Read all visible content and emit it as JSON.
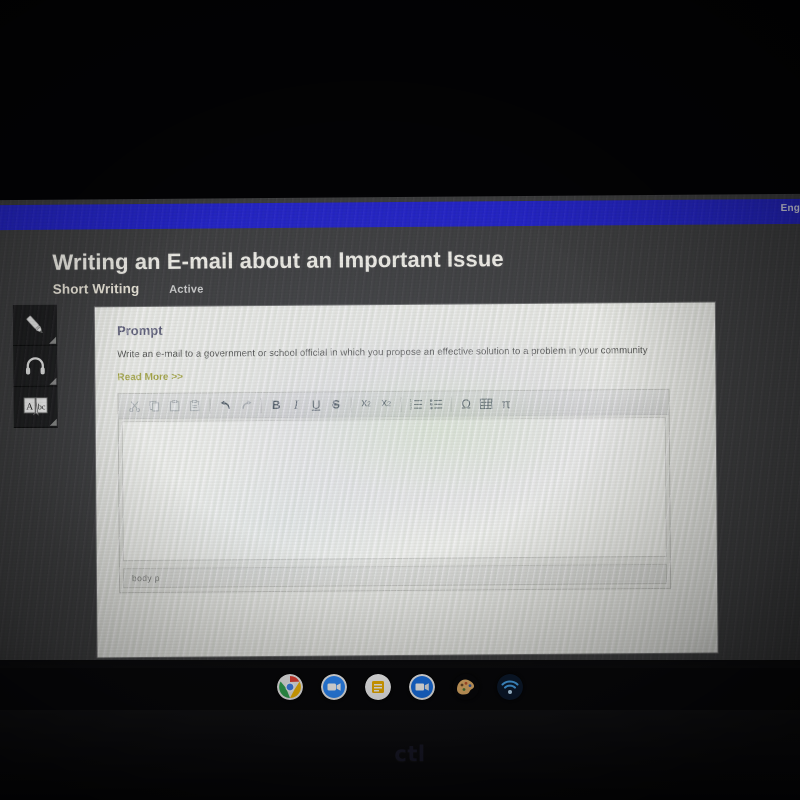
{
  "device": {
    "brand_logo": "ctl"
  },
  "browser": {
    "top_bar_color": "#2222c4",
    "language_label": "Eng"
  },
  "header": {
    "title": "Writing an E-mail about an Important Issue",
    "tab_label": "Short Writing",
    "status_label": "Active"
  },
  "toolrail": {
    "items": [
      {
        "icon": "pencil-icon",
        "name": "highlighter-tool"
      },
      {
        "icon": "headphones-icon",
        "name": "text-to-speech-tool"
      },
      {
        "icon": "dictionary-icon",
        "name": "dictionary-tool"
      }
    ]
  },
  "prompt": {
    "heading": "Prompt",
    "text": "Write an e-mail to a government or school official in which you propose an effective solution to a problem in your community",
    "read_more_label": "Read More >>",
    "read_more_color": "#9a9a2e",
    "heading_color": "#4a4a6a"
  },
  "editor": {
    "toolbar": [
      {
        "name": "cut-icon",
        "label": "✂",
        "enabled": false
      },
      {
        "name": "copy-icon",
        "label": "❐",
        "enabled": false
      },
      {
        "name": "paste-icon",
        "label": "ὌB",
        "enabled": false
      },
      {
        "name": "paste-from-word-icon",
        "label": "὜D",
        "enabled": false
      },
      {
        "name": "undo-icon",
        "label": "↶",
        "enabled": true
      },
      {
        "name": "redo-icon",
        "label": "↷",
        "enabled": false
      },
      {
        "name": "bold-button",
        "label": "B",
        "enabled": true
      },
      {
        "name": "italic-button",
        "label": "I",
        "enabled": true
      },
      {
        "name": "underline-button",
        "label": "U",
        "enabled": true
      },
      {
        "name": "strikethrough-button",
        "label": "S",
        "enabled": true
      },
      {
        "name": "subscript-button",
        "label": "x",
        "enabled": true
      },
      {
        "name": "superscript-button",
        "label": "x",
        "enabled": true
      },
      {
        "name": "numbered-list-icon",
        "label": "",
        "enabled": true
      },
      {
        "name": "bulleted-list-icon",
        "label": "",
        "enabled": true
      },
      {
        "name": "special-character-button",
        "label": "Ω",
        "enabled": true
      },
      {
        "name": "table-icon",
        "label": "",
        "enabled": true
      },
      {
        "name": "math-button",
        "label": "π",
        "enabled": true
      }
    ],
    "body_text": "",
    "element_path": "body  p"
  },
  "shelf": {
    "apps": [
      {
        "name": "chrome-app-icon"
      },
      {
        "name": "zoom-app-icon"
      },
      {
        "name": "keep-app-icon"
      },
      {
        "name": "meet-app-icon"
      },
      {
        "name": "paint-app-icon"
      },
      {
        "name": "wifi-app-icon"
      }
    ]
  }
}
